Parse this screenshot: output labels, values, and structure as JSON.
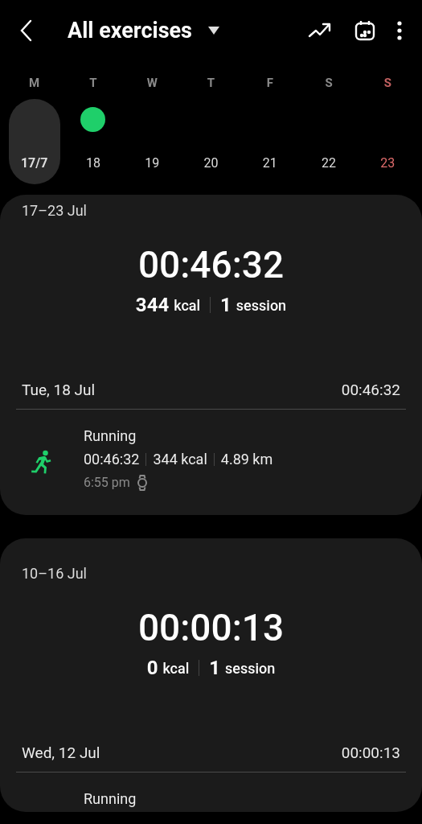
{
  "header": {
    "title": "All exercises"
  },
  "week": [
    {
      "day": "M",
      "date": "17/7",
      "selected": true,
      "weekend": false,
      "exercised": false
    },
    {
      "day": "T",
      "date": "18",
      "selected": false,
      "weekend": false,
      "exercised": true
    },
    {
      "day": "W",
      "date": "19",
      "selected": false,
      "weekend": false,
      "exercised": false
    },
    {
      "day": "T",
      "date": "20",
      "selected": false,
      "weekend": false,
      "exercised": false
    },
    {
      "day": "F",
      "date": "21",
      "selected": false,
      "weekend": false,
      "exercised": false
    },
    {
      "day": "S",
      "date": "22",
      "selected": false,
      "weekend": false,
      "exercised": false
    },
    {
      "day": "S",
      "date": "23",
      "selected": false,
      "weekend": true,
      "exercised": false
    }
  ],
  "summaries": [
    {
      "range": "17–23 Jul",
      "total_time": "00:46:32",
      "kcal": "344",
      "kcal_unit": "kcal",
      "sessions": "1",
      "sessions_unit": "session",
      "days": [
        {
          "date": "Tue, 18 Jul",
          "time": "00:46:32",
          "entries": [
            {
              "kind": "running",
              "name": "Running",
              "duration": "00:46:32",
              "kcal": "344 kcal",
              "distance": "4.89 km",
              "start": "6:55 pm",
              "watch": true
            }
          ]
        }
      ]
    },
    {
      "range": "10–16 Jul",
      "total_time": "00:00:13",
      "kcal": "0",
      "kcal_unit": "kcal",
      "sessions": "1",
      "sessions_unit": "session",
      "days": [
        {
          "date": "Wed, 12 Jul",
          "time": "00:00:13",
          "entries": [
            {
              "name": "Running"
            }
          ]
        }
      ]
    }
  ]
}
